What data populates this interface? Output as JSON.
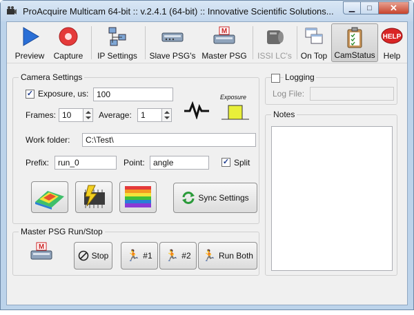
{
  "window": {
    "title": "ProAcquire Multicam 64-bit :: v.2.4.1 (64-bit)  ::  Innovative Scientific Solutions..."
  },
  "toolbar": {
    "items": [
      {
        "label": "Preview",
        "icon": "play-icon",
        "enabled": true
      },
      {
        "label": "Capture",
        "icon": "record-icon",
        "enabled": true
      },
      {
        "label": "IP Settings",
        "icon": "network-icon",
        "enabled": true
      },
      {
        "label": "Slave PSG's",
        "icon": "psg-device-icon",
        "enabled": true
      },
      {
        "label": "Master PSG",
        "icon": "master-psg-icon",
        "enabled": true
      },
      {
        "label": "ISSI LC's",
        "icon": "lc-camera-icon",
        "enabled": false
      },
      {
        "label": "On Top",
        "icon": "windows-stack-icon",
        "enabled": true
      },
      {
        "label": "CamStatus",
        "icon": "clipboard-checklist-icon",
        "enabled": true,
        "active": true
      },
      {
        "label": "Help",
        "icon": "help-icon",
        "enabled": true
      }
    ]
  },
  "camera_settings": {
    "title": "Camera Settings",
    "exposure_label": "Exposure, us:",
    "exposure_checked": true,
    "exposure_value": "100",
    "frames_label": "Frames:",
    "frames_value": "10",
    "average_label": "Average:",
    "average_value": "1",
    "exposure_indicator_label": "Exposure",
    "work_folder_label": "Work folder:",
    "work_folder_value": "C:\\Test\\",
    "prefix_label": "Prefix:",
    "prefix_value": "run_0",
    "point_label": "Point:",
    "point_value": "angle",
    "split_label": "Split",
    "split_checked": true,
    "sync_label": "Sync Settings"
  },
  "master_psg": {
    "title": "Master PSG Run/Stop",
    "stop_label": "Stop",
    "run1_label": "#1",
    "run2_label": "#2",
    "run_both_label": "Run Both"
  },
  "logging": {
    "label": "Logging",
    "checked": false,
    "log_file_label": "Log File:",
    "log_file_value": ""
  },
  "notes": {
    "title": "Notes",
    "value": ""
  },
  "colors": {
    "accent_yellow": "#e8ef3a",
    "window_frame": "#bcd3ea",
    "panel_bg": "#f0f0f0"
  }
}
